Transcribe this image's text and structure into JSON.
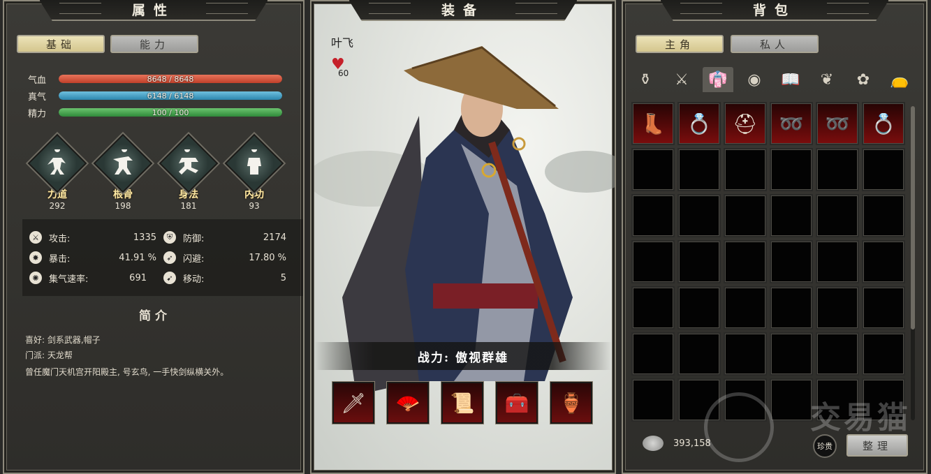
{
  "left": {
    "title": "属性",
    "tabs": [
      "基础",
      "能力"
    ],
    "bars": [
      {
        "label": "气血",
        "current": "8648",
        "max": "8648",
        "fill": 1.0,
        "color": "#d9553c"
      },
      {
        "label": "真气",
        "current": "6148",
        "max": "6148",
        "fill": 1.0,
        "color": "#3f9dc1"
      },
      {
        "label": "精力",
        "current": "100",
        "max": "100",
        "fill": 1.0,
        "color": "#3e9a4a"
      }
    ],
    "bar_values": [
      "8648 / 8648",
      "6148 / 6148",
      "100 / 100"
    ],
    "attributes": [
      {
        "name": "力道",
        "value": "292"
      },
      {
        "name": "根骨",
        "value": "198"
      },
      {
        "name": "身法",
        "value": "181"
      },
      {
        "name": "内功",
        "value": "93"
      }
    ],
    "combat": {
      "attack_label": "攻击:",
      "attack": "1335",
      "defense_label": "防御:",
      "defense": "2174",
      "crit_label": "暴击:",
      "crit": "41.91 %",
      "dodge_label": "闪避:",
      "dodge": "17.80 %",
      "qi_rate_label": "集气速率:",
      "qi_rate": "691",
      "move_label": "移动:",
      "move": "5"
    },
    "intro": {
      "title": "简介",
      "hobby": "喜好: 剑系武器,帽子",
      "sect": "门派: 天龙帮",
      "desc": "曾任魔门天机宫开阳殿主, 号玄鸟, 一手快剑纵横关外。"
    }
  },
  "middle": {
    "title": "装备",
    "char_name": "叶飞",
    "favor": "60",
    "power": "战力: 傲视群雄"
  },
  "right": {
    "title": "背包",
    "tabs": [
      "主角",
      "私人"
    ],
    "money": "393,158",
    "rare_label": "珍贵",
    "sort_label": "整理",
    "watermark": "交易猫"
  }
}
